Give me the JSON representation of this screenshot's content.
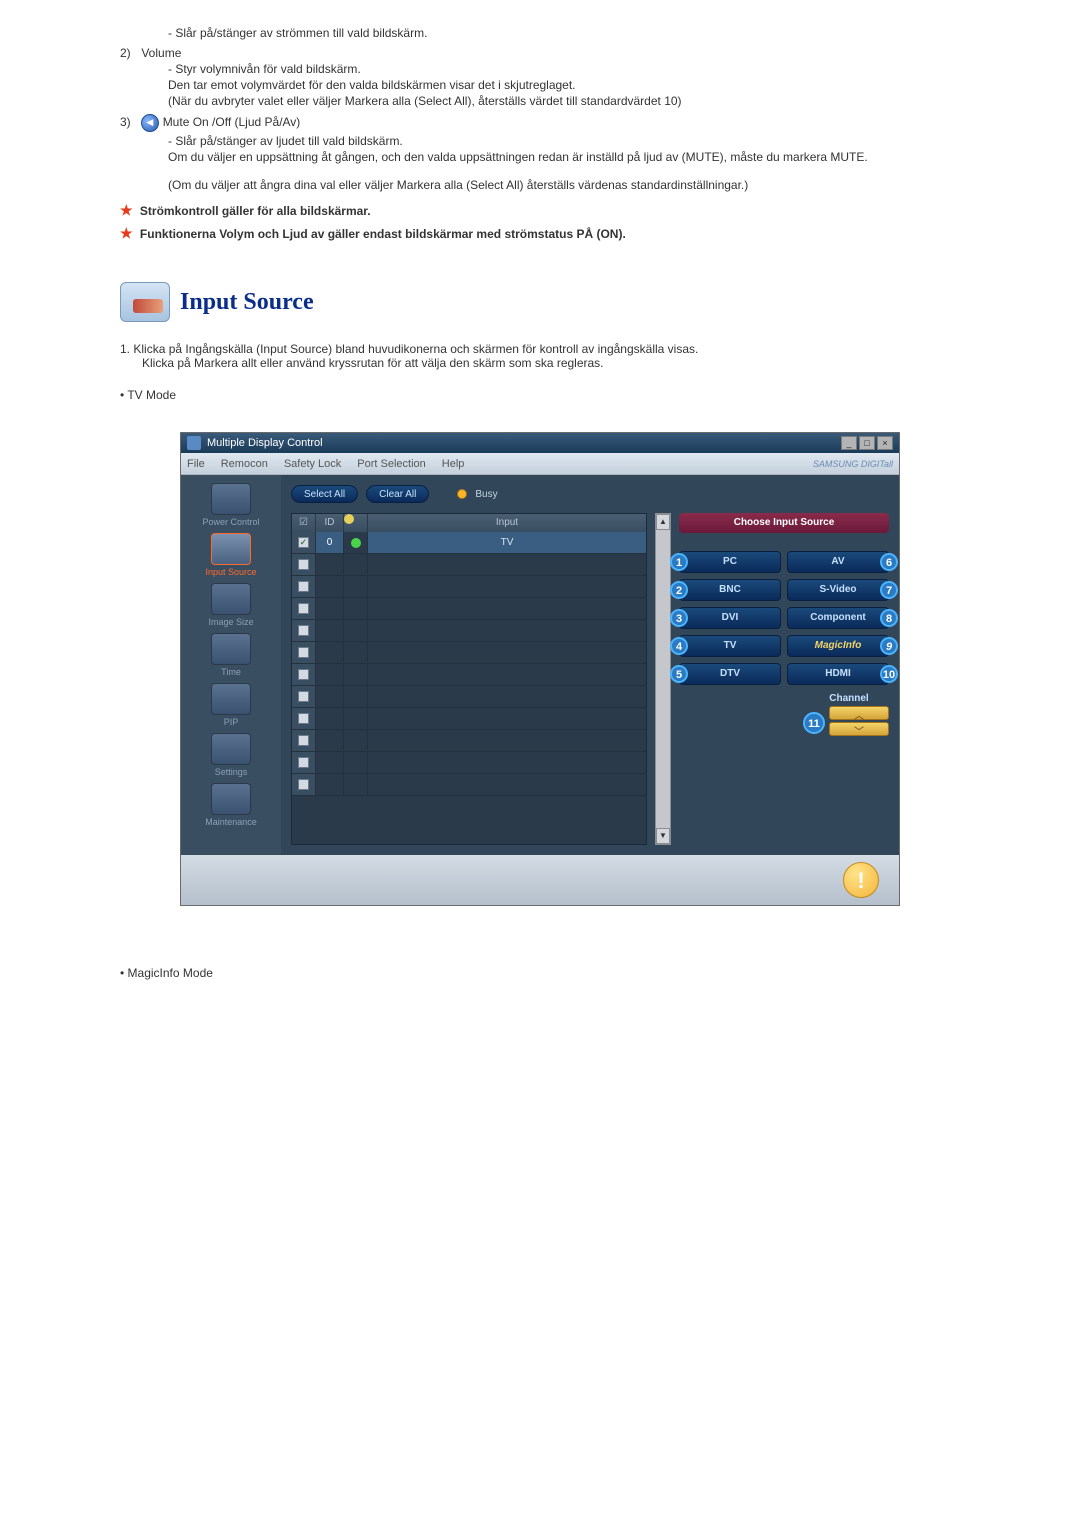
{
  "items": {
    "power_desc": "- Slår på/stänger av strömmen till vald bildskärm.",
    "volume": {
      "num": "2)",
      "label": "Volume",
      "line1": "- Styr volymnivån för vald bildskärm.",
      "line2": "Den tar emot volymvärdet för den valda bildskärmen visar det i skjutreglaget.",
      "line3": "(När du avbryter valet eller väljer Markera alla (Select All), återställs värdet till standardvärdet 10)"
    },
    "mute": {
      "num": "3)",
      "label": "Mute On /Off (Ljud På/Av)",
      "line1": "- Slår på/stänger av ljudet till vald bildskärm.",
      "line2": "Om du väljer en uppsättning åt gången, och den valda uppsättningen redan är inställd på ljud av (MUTE), måste du markera MUTE.",
      "line3": "(Om du väljer att ångra dina val eller väljer Markera alla (Select All) återställs värdenas standardinställningar.)"
    }
  },
  "notes": {
    "note1": "Strömkontroll gäller för alla bildskärmar.",
    "note2": "Funktionerna Volym och Ljud av gäller endast bildskärmar med strömstatus PÅ (ON)."
  },
  "heading": "Input Source",
  "steps": {
    "step1_num": "1.",
    "step1_line1": "Klicka på Ingångskälla (Input Source) bland huvudikonerna och skärmen för kontroll av ingångskälla visas.",
    "step1_line2": "Klicka på Markera allt eller använd kryssrutan för att välja den skärm som ska regleras."
  },
  "bullets": {
    "tv_mode": "• TV Mode",
    "magicinfo_mode": "• MagicInfo Mode"
  },
  "window": {
    "title": "Multiple Display Control",
    "menus": [
      "File",
      "Remocon",
      "Safety Lock",
      "Port Selection",
      "Help"
    ],
    "samsung": "SAMSUNG DIGITall",
    "buttons": {
      "select_all": "Select All",
      "clear_all": "Clear All",
      "busy": "Busy"
    },
    "sidebar": [
      "Power Control",
      "Input Source",
      "Image Size",
      "Time",
      "PIP",
      "Settings",
      "Maintenance"
    ],
    "table": {
      "headers": {
        "chk": "☑",
        "id": "ID",
        "status": "",
        "input": "Input"
      },
      "rows": [
        {
          "id": "0",
          "checked": true,
          "status": "green",
          "input": "TV",
          "active": true
        },
        {
          "id": "",
          "checked": false,
          "status": "",
          "input": ""
        },
        {
          "id": "",
          "checked": false,
          "status": "",
          "input": ""
        },
        {
          "id": "",
          "checked": false,
          "status": "",
          "input": ""
        },
        {
          "id": "",
          "checked": false,
          "status": "",
          "input": ""
        },
        {
          "id": "",
          "checked": false,
          "status": "",
          "input": ""
        },
        {
          "id": "",
          "checked": false,
          "status": "",
          "input": ""
        },
        {
          "id": "",
          "checked": false,
          "status": "",
          "input": ""
        },
        {
          "id": "",
          "checked": false,
          "status": "",
          "input": ""
        },
        {
          "id": "",
          "checked": false,
          "status": "",
          "input": ""
        },
        {
          "id": "",
          "checked": false,
          "status": "",
          "input": ""
        },
        {
          "id": "",
          "checked": false,
          "status": "",
          "input": ""
        }
      ]
    },
    "right": {
      "header": "Choose Input Source",
      "sources": {
        "pc": "PC",
        "av": "AV",
        "bnc": "BNC",
        "svideo": "S-Video",
        "dvi": "DVI",
        "component": "Component",
        "tv": "TV",
        "magicinfo": "MagicInfo",
        "dtv": "DTV",
        "hdmi": "HDMI"
      },
      "channel": "Channel",
      "up": "︿",
      "down": "﹀"
    },
    "annotations": {
      "a1": "1",
      "a2": "2",
      "a3": "3",
      "a4": "4",
      "a5": "5",
      "a6": "6",
      "a7": "7",
      "a8": "8",
      "a9": "9",
      "a10": "10",
      "a11": "11"
    }
  }
}
